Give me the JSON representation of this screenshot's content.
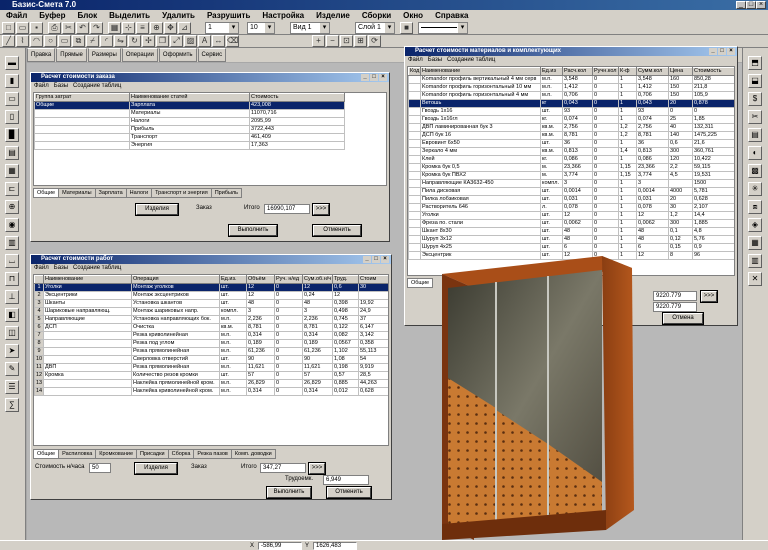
{
  "app": {
    "title": "Базис-Смета 7.0"
  },
  "menu": [
    "Файл",
    "Буфер",
    "Блок",
    "Выделить",
    "Удалить",
    "Разрушить",
    "Настройка",
    "Изделие",
    "Сборки",
    "Окно",
    "Справка"
  ],
  "toolbar": {
    "num1": "1",
    "num2": "10",
    "view": "Вид 1",
    "layer": "Слой 1"
  },
  "tabs": [
    "Правка",
    "Прямые",
    "Размеры",
    "Операции",
    "Оформить",
    "Сервис"
  ],
  "order_window": {
    "title": "Расчет стоимости заказа",
    "menu": [
      "Файл",
      "Базы",
      "Создание таблиц"
    ],
    "headers": [
      "Группа затрат",
      "Наименование статей",
      "Стоимость"
    ],
    "rows": [
      [
        "Общие",
        "Зарплата",
        "423,008"
      ],
      [
        "",
        "Материалы",
        "11070,716"
      ],
      [
        "",
        "Налоги",
        "2095,99"
      ],
      [
        "",
        "Прибыль",
        "3722,443"
      ],
      [
        "",
        "Транспорт",
        "461,409"
      ],
      [
        "",
        "Энергия",
        "17,363"
      ]
    ],
    "tabs": [
      "Общие",
      "Материалы",
      "Зарплата",
      "Налоги",
      "Транспорт и энергия",
      "Прибыль"
    ],
    "item_btn": "Изделия",
    "zakaz_label": "Заказ",
    "total_label": "Итого",
    "total_value": "16990,107",
    "perform_btn": "Выполнить",
    "cancel_btn": "Отменить"
  },
  "works_window": {
    "title": "Расчет стоимости работ",
    "menu": [
      "Файл",
      "Базы",
      "Создание таблиц"
    ],
    "headers": [
      "",
      "Наименование",
      "Операция",
      "Ед.из.",
      "Объём",
      "Руч. н/ед",
      "Сум.об.н/ч",
      "Труд.",
      "Стоим"
    ],
    "rows": [
      [
        "1",
        "Уголки",
        "Монтаж уголков",
        "шт.",
        "12",
        "0",
        "12",
        "0,6",
        "30"
      ],
      [
        "2",
        "Эксцентрики",
        "Монтаж эксцентриков",
        "шт.",
        "12",
        "0",
        "0,24",
        "12",
        ""
      ],
      [
        "3",
        "Шканты",
        "Установка шкантов",
        "шт.",
        "48",
        "0",
        "48",
        "0,398",
        "19,92"
      ],
      [
        "4",
        "Шариковые направляющ.",
        "Монтаж шариковых напр.",
        "компл.",
        "3",
        "0",
        "3",
        "0,498",
        "24,9"
      ],
      [
        "5",
        "Направляющие",
        "Установка направляющих бок.",
        "м.п.",
        "2,236",
        "0",
        "2,236",
        "0,745",
        "37"
      ],
      [
        "6",
        "ДСП",
        "Очистка",
        "кв.м.",
        "8,781",
        "0",
        "8,781",
        "0,122",
        "6,147"
      ],
      [
        "7",
        "",
        "Резка криволинейная",
        "м.п.",
        "0,314",
        "0",
        "0,314",
        "0,082",
        "3,142"
      ],
      [
        "8",
        "",
        "Резка под углом",
        "м.п.",
        "0,189",
        "0",
        "0,189",
        "0,0567",
        "0,358"
      ],
      [
        "9",
        "",
        "Резка прямолинейная",
        "м.п.",
        "61,236",
        "0",
        "61,236",
        "1,102",
        "55,113"
      ],
      [
        "10",
        "",
        "Сверловка отверстий",
        "шт.",
        "90",
        "0",
        "90",
        "1,08",
        "54"
      ],
      [
        "11",
        "ДВП",
        "Резка прямолинейная",
        "м.п.",
        "11,621",
        "0",
        "11,621",
        "0,198",
        "9,919"
      ],
      [
        "12",
        "Кромка",
        "Количество резов кромки",
        "шт.",
        "57",
        "0",
        "57",
        "0,57",
        "28,5"
      ],
      [
        "13",
        "",
        "Наклейка прямолинейной кром.",
        "м.п.",
        "26,829",
        "0",
        "26,829",
        "0,885",
        "44,263"
      ],
      [
        "14",
        "",
        "Наклейка криволинейной кром.",
        "м.п.",
        "0,314",
        "0",
        "0,314",
        "0,012",
        "0,628"
      ]
    ],
    "tabs": [
      "Общие",
      "Распиловка",
      "Кромкование",
      "Присадки",
      "Сборка",
      "Резка пазов",
      "Комп. доводки"
    ],
    "cost_label": "Стоимость н/часа",
    "cost_value": "50",
    "item_btn": "Изделия",
    "zakaz_label": "Заказ",
    "total_label": "Итого",
    "total_value": "347,27",
    "labor_label": "Трудоемк.",
    "labor_value": "6,949",
    "perform_btn": "Выполнить",
    "cancel_btn": "Отменить"
  },
  "materials_window": {
    "title": "Расчет стоимости материалов и комплектующих",
    "menu": [
      "Файл",
      "Базы",
      "Создание таблиц"
    ],
    "headers": [
      "Код",
      "Наименование",
      "Ед.из",
      "Расч.кол",
      "Ручн.кол",
      "К-ф",
      "Сумм.кол",
      "Цена",
      "Стоимость"
    ],
    "rows": [
      [
        "",
        "Komandor профиль вертикальный 4 мм серв",
        "м.п.",
        "3,548",
        "0",
        "1",
        "3,548",
        "160",
        "850,28"
      ],
      [
        "",
        "Komandor профиль горизонтальный 10 мм",
        "м.п.",
        "1,412",
        "0",
        "1",
        "1,412",
        "150",
        "211,8"
      ],
      [
        "",
        "Komandor профиль горизонтальный 4 мм",
        "м.п.",
        "0,706",
        "0",
        "1",
        "0,706",
        "150",
        "105,9"
      ],
      [
        "",
        "Ветошь",
        "кг",
        "0,043",
        "0",
        "1",
        "0,043",
        "20",
        "0,878"
      ],
      [
        "",
        "Гвоздь 1x16",
        "шт.",
        "93",
        "0",
        "1",
        "93",
        "0",
        "0"
      ],
      [
        "",
        "Гвоздь 1x16гл",
        "кг.",
        "0,074",
        "0",
        "1",
        "0,074",
        "25",
        "1,85"
      ],
      [
        "",
        "ДВП ламинированная бук 3",
        "кв.м.",
        "2,756",
        "0",
        "1,2",
        "2,756",
        "40",
        "132,311"
      ],
      [
        "",
        "ДСП бук 16",
        "кв.м.",
        "8,781",
        "0",
        "1,2",
        "8,781",
        "140",
        "1475,225"
      ],
      [
        "",
        "Евровинт 6x50",
        "шт.",
        "36",
        "0",
        "1",
        "36",
        "0,6",
        "21,6"
      ],
      [
        "",
        "Зеркало 4 мм",
        "кв.м.",
        "0,813",
        "0",
        "1,4",
        "0,813",
        "300",
        "360,761"
      ],
      [
        "",
        "Клей",
        "кг.",
        "0,086",
        "0",
        "1",
        "0,086",
        "120",
        "10,422"
      ],
      [
        "",
        "Кромка бук 0,5",
        "м.",
        "23,366",
        "0",
        "1,15",
        "23,366",
        "2,2",
        "59,115"
      ],
      [
        "",
        "Кромка бук ПВХ2",
        "м.",
        "3,774",
        "0",
        "1,15",
        "3,774",
        "4,5",
        "19,531"
      ],
      [
        "",
        "Направляющие КА3632-450",
        "компл.",
        "3",
        "0",
        "1",
        "3",
        "",
        "1500"
      ],
      [
        "",
        "Пила дисковая",
        "шт.",
        "0,0014",
        "0",
        "1",
        "0,0014",
        "4000",
        "5,781"
      ],
      [
        "",
        "Пилка лобзиковая",
        "шт.",
        "0,031",
        "0",
        "1",
        "0,031",
        "20",
        "0,628"
      ],
      [
        "",
        "Растворитель 646",
        "л.",
        "0,078",
        "0",
        "1",
        "0,078",
        "30",
        "2,107"
      ],
      [
        "",
        "Уголки",
        "шт.",
        "12",
        "0",
        "1",
        "12",
        "1,2",
        "14,4"
      ],
      [
        "",
        "Фреза по. стали",
        "шт.",
        "0,0062",
        "0",
        "1",
        "0,0062",
        "300",
        "1,885"
      ],
      [
        "",
        "Шкант 8x30",
        "шт.",
        "48",
        "0",
        "1",
        "48",
        "0,1",
        "4,8"
      ],
      [
        "",
        "Шуруп 3x12",
        "шт.",
        "48",
        "0",
        "1",
        "48",
        "0,12",
        "5,76"
      ],
      [
        "",
        "Шуруп 4x25",
        "шт.",
        "6",
        "0",
        "1",
        "6",
        "0,15",
        "0,9"
      ],
      [
        "",
        "Эксцентрик",
        "шт.",
        "12",
        "0",
        "1",
        "12",
        "8",
        "96"
      ]
    ],
    "tab_general": "Общие",
    "total_a": "9220.779",
    "total_b": "9220.779",
    "cancel_btn": "Отмена"
  },
  "status": {
    "x_label": "X",
    "x_value": "-586,99",
    "y_label": "Y",
    "y_value": "1626,483"
  }
}
